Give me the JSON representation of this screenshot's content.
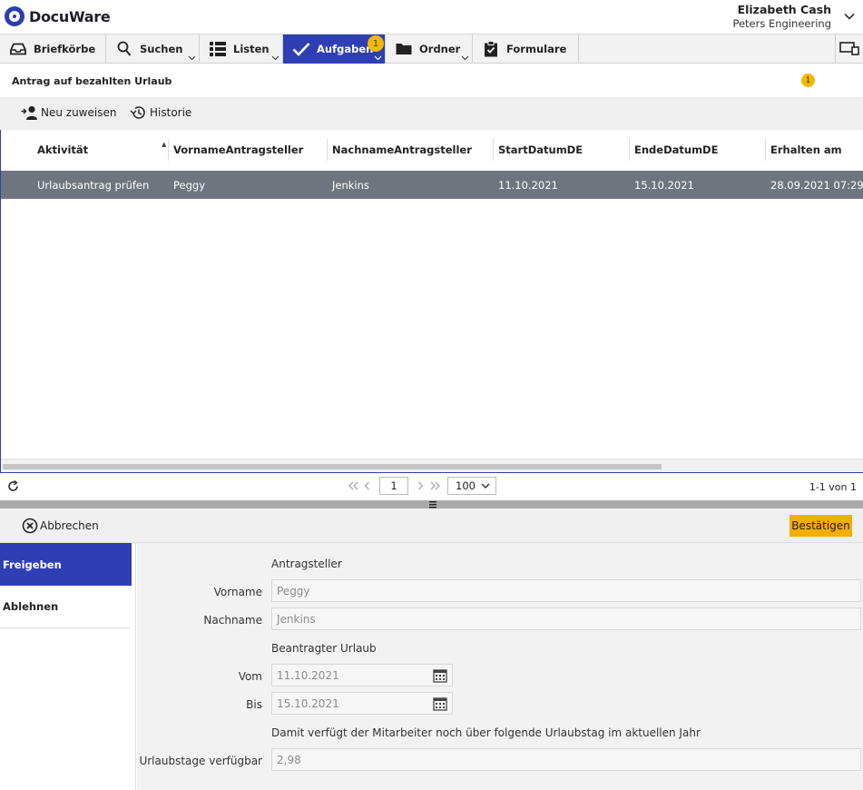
{
  "app": {
    "logo_text": "DocuWare"
  },
  "user": {
    "name": "Elizabeth Cash",
    "company": "Peters Engineering"
  },
  "nav": {
    "items": [
      {
        "label": "Briefkörbe"
      },
      {
        "label": "Suchen"
      },
      {
        "label": "Listen"
      },
      {
        "label": "Aufgaben",
        "badge": "1"
      },
      {
        "label": "Ordner"
      },
      {
        "label": "Formulare"
      }
    ]
  },
  "task": {
    "title": "Antrag auf bezahlten Urlaub",
    "badge": "1"
  },
  "toolbar": {
    "reassign_label": "Neu zuweisen",
    "history_label": "Historie"
  },
  "grid": {
    "columns": [
      "Aktivität",
      "VornameAntragsteller",
      "NachnameAntragsteller",
      "StartDatumDE",
      "EndeDatumDE",
      "Erhalten am"
    ],
    "rows": [
      [
        "Urlaubsantrag prüfen",
        "Peggy",
        "Jenkins",
        "11.10.2021",
        "15.10.2021",
        "28.09.2021 07:29"
      ]
    ]
  },
  "pager": {
    "page": "1",
    "page_size": "100",
    "count_text": "1-1 von 1"
  },
  "form_bar": {
    "cancel_label": "Abbrechen",
    "confirm_label": "Bestätigen"
  },
  "sidebar": {
    "tabs": [
      {
        "label": "Freigeben"
      },
      {
        "label": "Ablehnen"
      }
    ]
  },
  "form": {
    "section_applicant": "Antragsteller",
    "first_name_label": "Vorname",
    "first_name_value": "Peggy",
    "last_name_label": "Nachname",
    "last_name_value": "Jenkins",
    "section_leave": "Beantragter Urlaub",
    "from_label": "Vom",
    "from_value": "11.10.2021",
    "to_label": "Bis",
    "to_value": "15.10.2021",
    "note": "Damit verfügt der Mitarbeiter noch über folgende Urlaubstag im aktuellen Jahr",
    "days_label": "Urlaubstage verfügbar",
    "days_value": "2,98"
  },
  "colors": {
    "accent": "#2f3fb3",
    "badge": "#f5b800",
    "confirm": "#f5ad00",
    "row_selected": "#6f757e"
  }
}
